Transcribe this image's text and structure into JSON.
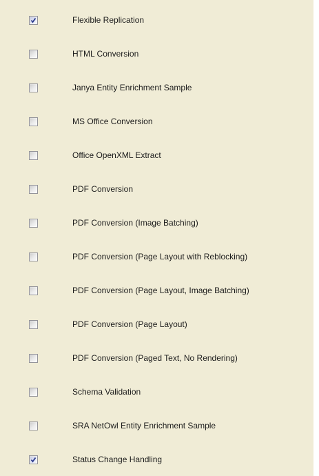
{
  "options": [
    {
      "label": "Flexible Replication",
      "checked": true
    },
    {
      "label": "HTML Conversion",
      "checked": false
    },
    {
      "label": "Janya Entity Enrichment Sample",
      "checked": false
    },
    {
      "label": "MS Office Conversion",
      "checked": false
    },
    {
      "label": "Office OpenXML Extract",
      "checked": false
    },
    {
      "label": "PDF Conversion",
      "checked": false
    },
    {
      "label": "PDF Conversion (Image Batching)",
      "checked": false
    },
    {
      "label": "PDF Conversion (Page Layout with Reblocking)",
      "checked": false
    },
    {
      "label": "PDF Conversion (Page Layout, Image Batching)",
      "checked": false
    },
    {
      "label": "PDF Conversion (Page Layout)",
      "checked": false
    },
    {
      "label": "PDF Conversion (Paged Text, No Rendering)",
      "checked": false
    },
    {
      "label": "Schema Validation",
      "checked": false
    },
    {
      "label": "SRA NetOwl Entity Enrichment Sample",
      "checked": false
    },
    {
      "label": "Status Change Handling",
      "checked": true
    }
  ],
  "colors": {
    "panel_background": "#f0ecd6",
    "checkmark": "#2a3a8c",
    "checkbox_border": "#94949a",
    "label_text": "#1c1c1c"
  },
  "icons": {
    "checked": "checkmark-icon"
  }
}
